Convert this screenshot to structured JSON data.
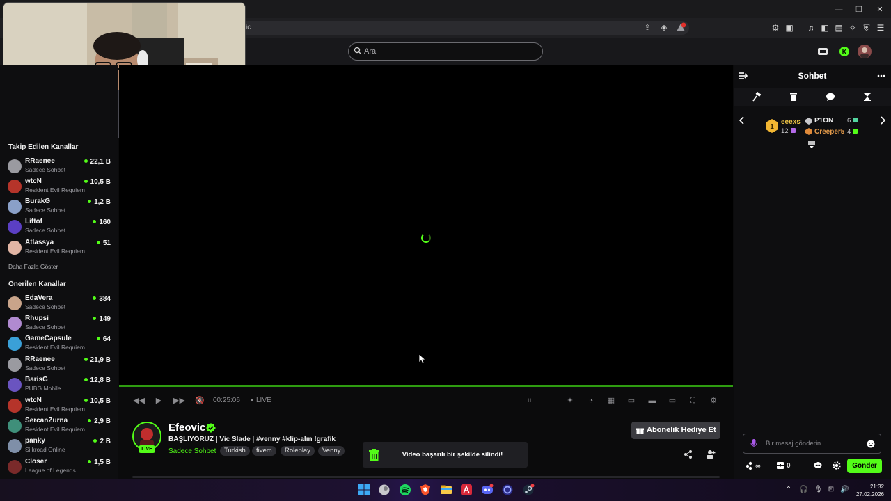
{
  "browser": {
    "url_fragment": "vic"
  },
  "header": {
    "search_placeholder": "Ara"
  },
  "sidebar": {
    "followed_title": "Takip Edilen Kanallar",
    "followed": [
      {
        "name": "RRaenee",
        "game": "Sadece Sohbet",
        "viewers": "22,1 B",
        "avatar_color": "#9a9aa0"
      },
      {
        "name": "wtcN",
        "game": "Resident Evil Requiem",
        "viewers": "10,5 B",
        "avatar_color": "#b5342a"
      },
      {
        "name": "BurakG",
        "game": "Sadece Sohbet",
        "viewers": "1,2 B",
        "avatar_color": "#8aa0c8"
      },
      {
        "name": "Liftof",
        "game": "Sadece Sohbet",
        "viewers": "160",
        "avatar_color": "#5b3fc4"
      },
      {
        "name": "Atlassya",
        "game": "Resident Evil Requiem",
        "viewers": "51",
        "avatar_color": "#e2b5a4"
      }
    ],
    "show_more": "Daha Fazla Göster",
    "recommended_title": "Önerilen Kanallar",
    "recommended": [
      {
        "name": "EdaVera",
        "game": "Sadece Sohbet",
        "viewers": "384",
        "avatar_color": "#c9a48a"
      },
      {
        "name": "Rhupsi",
        "game": "Sadece Sohbet",
        "viewers": "149",
        "avatar_color": "#b08ad0"
      },
      {
        "name": "GameCapsule",
        "game": "Resident Evil Requiem",
        "viewers": "64",
        "avatar_color": "#3aa0d8"
      },
      {
        "name": "RRaenee",
        "game": "Sadece Sohbet",
        "viewers": "21,9 B",
        "avatar_color": "#9a9aa0"
      },
      {
        "name": "BarisG",
        "game": "PUBG Mobile",
        "viewers": "12,8 B",
        "avatar_color": "#6a54c0"
      },
      {
        "name": "wtcN",
        "game": "Resident Evil Requiem",
        "viewers": "10,5 B",
        "avatar_color": "#b5342a"
      },
      {
        "name": "SercanZurna",
        "game": "Resident Evil Requiem",
        "viewers": "2,9 B",
        "avatar_color": "#3f8f7a"
      },
      {
        "name": "panky",
        "game": "Silkroad Online",
        "viewers": "2 B",
        "avatar_color": "#7f8fa8"
      },
      {
        "name": "Closer",
        "game": "League of Legends",
        "viewers": "1,5 B",
        "avatar_color": "#7a2a2a"
      }
    ]
  },
  "player": {
    "time": "00:25:06",
    "live_label": "LIVE",
    "progress": 1.0
  },
  "stream": {
    "streamer": "Efeovic",
    "live_badge": "LIVE",
    "title": "BAŞLIYORUZ | Vic Slade | #venny #klip-alın !grafik",
    "category": "Sadece Sohbet",
    "tags": [
      "Turkish",
      "fivem",
      "Roleplay",
      "Venny"
    ],
    "gift_button": "Abonelik Hediye Et",
    "toast": "Video başarılı bir şekilde silindi!"
  },
  "chat": {
    "title": "Sohbet",
    "leaderboard": [
      {
        "rank": "1",
        "name": "eeexs",
        "count": "12",
        "color": "#b36ae8"
      },
      {
        "name": "P1ON",
        "count": "6",
        "color": "#53d6a0"
      },
      {
        "name": "Creeper5",
        "count": "4",
        "color": "#53fc18"
      }
    ],
    "input_placeholder": "Bir mesaj gönderin",
    "points": "0",
    "send_label": "Gönder"
  },
  "taskbar": {
    "time": "21:32",
    "date": "27.02.2026"
  },
  "colors": {
    "accent": "#53fc18",
    "background": "#0e0e10"
  }
}
